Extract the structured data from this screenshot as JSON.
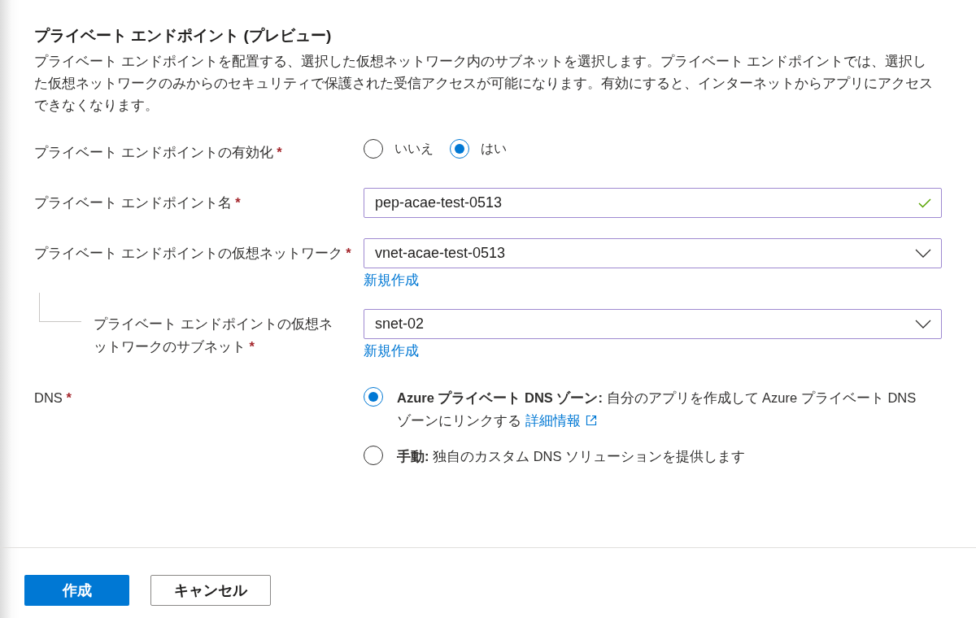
{
  "section": {
    "title": "プライベート エンドポイント (プレビュー)",
    "description": "プライベート エンドポイントを配置する、選択した仮想ネットワーク内のサブネットを選択します。プライベート エンドポイントでは、選択した仮想ネットワークのみからのセキュリティで保護された受信アクセスが可能になります。有効にすると、インターネットからアプリにアクセスできなくなります。"
  },
  "fields": [
    {
      "kind": "radio",
      "label": "プライベート エンドポイントの有効化",
      "required": "*",
      "options": [
        {
          "label": "いいえ",
          "selected": false
        },
        {
          "label": "はい",
          "selected": true
        }
      ]
    },
    {
      "kind": "text",
      "label": "プライベート エンドポイント名",
      "required": "*",
      "value": "pep-acae-test-0513",
      "valid": true
    },
    {
      "kind": "dropdown",
      "label": "プライベート エンドポイントの仮想ネットワーク",
      "required": "*",
      "value": "vnet-acae-test-0513",
      "link": "新規作成",
      "nested": false
    },
    {
      "kind": "dropdown",
      "label": "プライベート エンドポイントの仮想ネットワークのサブネット",
      "required": "*",
      "value": "snet-02",
      "link": "新規作成",
      "nested": true
    },
    {
      "kind": "options",
      "label": "DNS",
      "required": "*",
      "options": [
        {
          "text": "**Azure プライベート DNS ゾーン:** 自分のアプリを作成して Azure プライベート DNS ゾーンにリンクする",
          "link": "詳細情報",
          "selected": true
        },
        {
          "text": "**手動:** 独自のカスタム DNS ソリューションを提供します",
          "selected": false
        }
      ]
    }
  ],
  "buttons": [
    {
      "label": "作成",
      "primary": true
    },
    {
      "label": "キャンセル",
      "primary": false
    }
  ]
}
